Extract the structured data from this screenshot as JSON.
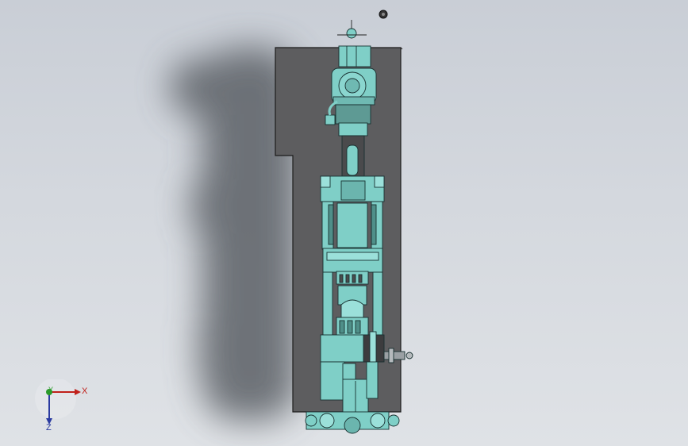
{
  "viewport": {
    "background_top": "#c9ced6",
    "background_bottom": "#dfe2e6"
  },
  "model": {
    "part_color": "#7fcfc7",
    "part_dark": "#4f8f89",
    "plate_color": "#5e5e60",
    "edge_color": "#1b2b2b"
  },
  "triad": {
    "x_label": "X",
    "y_label": "Y",
    "z_label": "Z",
    "x_color": "#c0201a",
    "y_color": "#2a9a2a",
    "z_color": "#2a3aa0"
  }
}
